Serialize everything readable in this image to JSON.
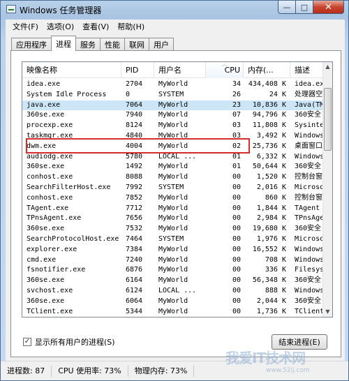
{
  "window": {
    "title": "Windows 任务管理器",
    "min_label": "—",
    "max_label": "□",
    "close_label": "✕"
  },
  "menu": [
    {
      "label": "文件(F)"
    },
    {
      "label": "选项(O)"
    },
    {
      "label": "查看(V)"
    },
    {
      "label": "帮助(H)"
    }
  ],
  "tabs": [
    {
      "label": "应用程序",
      "active": false
    },
    {
      "label": "进程",
      "active": true
    },
    {
      "label": "服务",
      "active": false
    },
    {
      "label": "性能",
      "active": false
    },
    {
      "label": "联网",
      "active": false
    },
    {
      "label": "用户",
      "active": false
    }
  ],
  "columns": {
    "name": "映像名称",
    "pid": "PID",
    "user": "用户名",
    "cpu": "CPU",
    "mem": "内存(...",
    "desc": "描述"
  },
  "sort_indicator": "︿",
  "processes": [
    {
      "name": "idea.exe",
      "pid": "2704",
      "user": "MyWorld",
      "cpu": "34",
      "mem": "434,408 K",
      "desc": "idea.exe"
    },
    {
      "name": "System Idle Process",
      "pid": "0",
      "user": "SYSTEM",
      "cpu": "26",
      "mem": "24 K",
      "desc": "处理器空"
    },
    {
      "name": "java.exe",
      "pid": "7064",
      "user": "MyWorld",
      "cpu": "23",
      "mem": "10,836 K",
      "desc": "Java(TM"
    },
    {
      "name": "360se.exe",
      "pid": "7940",
      "user": "MyWorld",
      "cpu": "07",
      "mem": "94,796 K",
      "desc": "360安全"
    },
    {
      "name": "procexp.exe",
      "pid": "8124",
      "user": "MyWorld",
      "cpu": "03",
      "mem": "11,808 K",
      "desc": "Sysinte"
    },
    {
      "name": "taskmgr.exe",
      "pid": "4840",
      "user": "MyWorld",
      "cpu": "03",
      "mem": "3,492 K",
      "desc": "Windows"
    },
    {
      "name": "dwm.exe",
      "pid": "4004",
      "user": "MyWorld",
      "cpu": "02",
      "mem": "25,736 K",
      "desc": "桌面窗口"
    },
    {
      "name": "audiodg.exe",
      "pid": "5780",
      "user": "LOCAL ...",
      "cpu": "01",
      "mem": "6,332 K",
      "desc": "Windows"
    },
    {
      "name": "360se.exe",
      "pid": "1492",
      "user": "MyWorld",
      "cpu": "01",
      "mem": "50,644 K",
      "desc": "360安全"
    },
    {
      "name": "conhost.exe",
      "pid": "8088",
      "user": "MyWorld",
      "cpu": "00",
      "mem": "1,520 K",
      "desc": "控制台窗"
    },
    {
      "name": "SearchFilterHost.exe",
      "pid": "7992",
      "user": "SYSTEM",
      "cpu": "00",
      "mem": "2,016 K",
      "desc": "Microso"
    },
    {
      "name": "conhost.exe",
      "pid": "7852",
      "user": "MyWorld",
      "cpu": "00",
      "mem": "860 K",
      "desc": "控制台窗"
    },
    {
      "name": "TAgent.exe",
      "pid": "7712",
      "user": "MyWorld",
      "cpu": "00",
      "mem": "1,844 K",
      "desc": "TAgent"
    },
    {
      "name": "TPnsAgent.exe",
      "pid": "7656",
      "user": "MyWorld",
      "cpu": "00",
      "mem": "2,984 K",
      "desc": "TPnsAge"
    },
    {
      "name": "360se.exe",
      "pid": "7532",
      "user": "MyWorld",
      "cpu": "00",
      "mem": "19,680 K",
      "desc": "360安全"
    },
    {
      "name": "SearchProtocolHost.exe",
      "pid": "7464",
      "user": "SYSTEM",
      "cpu": "00",
      "mem": "1,976 K",
      "desc": "Microso"
    },
    {
      "name": "explorer.exe",
      "pid": "7384",
      "user": "MyWorld",
      "cpu": "00",
      "mem": "16,552 K",
      "desc": "Windows"
    },
    {
      "name": "cmd.exe",
      "pid": "7240",
      "user": "MyWorld",
      "cpu": "00",
      "mem": "708 K",
      "desc": "Windows"
    },
    {
      "name": "fsnotifier.exe",
      "pid": "6876",
      "user": "MyWorld",
      "cpu": "00",
      "mem": "336 K",
      "desc": "Filesys"
    },
    {
      "name": "360se.exe",
      "pid": "6164",
      "user": "MyWorld",
      "cpu": "00",
      "mem": "56,348 K",
      "desc": "360安全"
    },
    {
      "name": "svchost.exe",
      "pid": "6124",
      "user": "LOCAL ...",
      "cpu": "00",
      "mem": "888 K",
      "desc": "Windows"
    },
    {
      "name": "360se.exe",
      "pid": "6064",
      "user": "MyWorld",
      "cpu": "00",
      "mem": "2,044 K",
      "desc": "360安全"
    },
    {
      "name": "TClient.exe",
      "pid": "5344",
      "user": "MyWorld",
      "cpu": "00",
      "mem": "1,736 K",
      "desc": "TClient"
    }
  ],
  "selected_index": 2,
  "show_all": {
    "label": "显示所有用户的进程(S)",
    "checked": true,
    "check_glyph": "✓"
  },
  "end_process_label": "结束进程(E)",
  "status": {
    "processes": "进程数: 87",
    "cpu": "CPU 使用率: 73%",
    "memory": "物理内存: 73%"
  },
  "watermark": {
    "text": "我爱IT技术网",
    "url": "www.52ij.com"
  },
  "scroll": {
    "up": "▲",
    "down": "▼"
  }
}
